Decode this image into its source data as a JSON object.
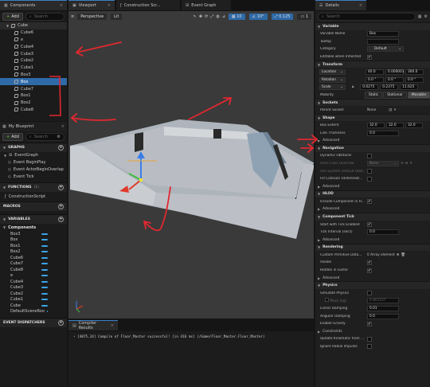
{
  "components": {
    "tab": "Components",
    "add_label": "Add",
    "search_placeholder": "Search",
    "root": "Cube",
    "items": [
      "Cube6",
      "e",
      "Cube4",
      "Cube3",
      "Cube2",
      "Cube1",
      "Box3",
      "Box",
      "Cube7",
      "Box1",
      "Box2",
      "Cube8"
    ],
    "selected_index": 7
  },
  "blueprint": {
    "tab": "My Blueprint",
    "add_label": "Add",
    "search_placeholder": "Search",
    "graphs_label": "GRAPHS",
    "event_graph": "EventGraph",
    "events": [
      "Event BeginPlay",
      "Event ActorBeginOverlap",
      "Event Tick"
    ],
    "functions_label": "FUNCTIONS",
    "functions_count": "(1)",
    "function_items": [
      "ConstructionScript"
    ],
    "macros_label": "MACROS",
    "variables_label": "VARIABLES",
    "components_group": "Components",
    "variables": [
      "Box3",
      "Box",
      "Box1",
      "Box2",
      "Cube6",
      "Cube7",
      "Cube8",
      "e",
      "Cube4",
      "Cube3",
      "Cube2",
      "Cube1",
      "Cube",
      "DefaultSceneRoo"
    ],
    "dispatchers_label": "EVENT DISPATCHERS",
    "var_color": "#3aa3e8"
  },
  "tabs": {
    "viewport": "Viewport",
    "construction": "Construction Scr...",
    "event_graph": "Event Graph"
  },
  "viewport": {
    "perspective": "Perspective",
    "lit": "Lit",
    "grid_snap": "10",
    "rot_snap": "10°",
    "scale_snap": "0.125",
    "cam_speed": "1"
  },
  "compiler": {
    "tab": "Compiler Results",
    "message": "[4075.24] Compile of Floor_Master successful! [in 416 ms] (/Game/Floor_Master.Floor_Master)"
  },
  "details": {
    "tab": "Details",
    "search_placeholder": "Search",
    "sections": {
      "variable": "Variable",
      "transform": "Transform",
      "sockets": "Sockets",
      "shape": "Shape",
      "advanced": "Advanced",
      "navigation": "Navigation",
      "hlod": "HLOD",
      "component_tick": "Component Tick",
      "rendering": "Rendering",
      "physics": "Physics"
    },
    "variable_name_label": "Variable Name",
    "variable_name": "Box",
    "tooltip_label": "Tooltip",
    "category_label": "Category",
    "category": "Default",
    "editable_label": "Editable when Inherited",
    "location_label": "Location",
    "location": [
      "40.0",
      "0.000001",
      "300.0"
    ],
    "rotation_label": "Rotation",
    "rotation": [
      "0.0 °",
      "0.0 °",
      "0.0 °"
    ],
    "scale_label": "Scale",
    "scale": [
      "0.0275",
      "0.2375",
      "11.625"
    ],
    "mobility_label": "Mobility",
    "mobility": [
      "Static",
      "Stationar",
      "Movable"
    ],
    "parent_socket_label": "Parent Socket",
    "parent_socket": "None",
    "box_extent_label": "Box Extent",
    "box_extent": [
      "32.0",
      "32.0",
      "32.0"
    ],
    "line_thickness_label": "Line Thickness",
    "line_thickness": "0.0",
    "dynamic_obstacle_label": "Dynamic Obstacle",
    "area_class_override_label": "Area Class Override",
    "area_class_override": "None",
    "use_system_default_label": "Use System Default Obst...",
    "fill_collision_label": "Fill Collision Underneat...",
    "include_hlod_label": "Include Component in H...",
    "start_tick_label": "Start with Tick Enabled",
    "tick_interval_label": "Tick Interval (secs)",
    "tick_interval": "0.0",
    "custom_primitive_label": "Custom Primitive Data...",
    "custom_primitive": "0 Array element",
    "visible_label": "Visible",
    "hidden_label": "Hidden in Game",
    "simulate_label": "Simulate Physics",
    "mass_label": "Mass (kg)",
    "mass": "6.801107",
    "linear_damping_label": "Linear Damping",
    "linear_damping": "0.01",
    "angular_damping_label": "Angular Damping",
    "angular_damping": "0.0",
    "enable_gravity_label": "Enable Gravity",
    "constraints_label": "Constraints",
    "update_kinematic_label": "Update Kinematic from ...",
    "ignore_radial_label": "Ignore Radial Impulse"
  },
  "colors": {
    "accent": "#2e6aa8",
    "annotation": "#e0282f",
    "checkbox_check": "#ffffff"
  }
}
